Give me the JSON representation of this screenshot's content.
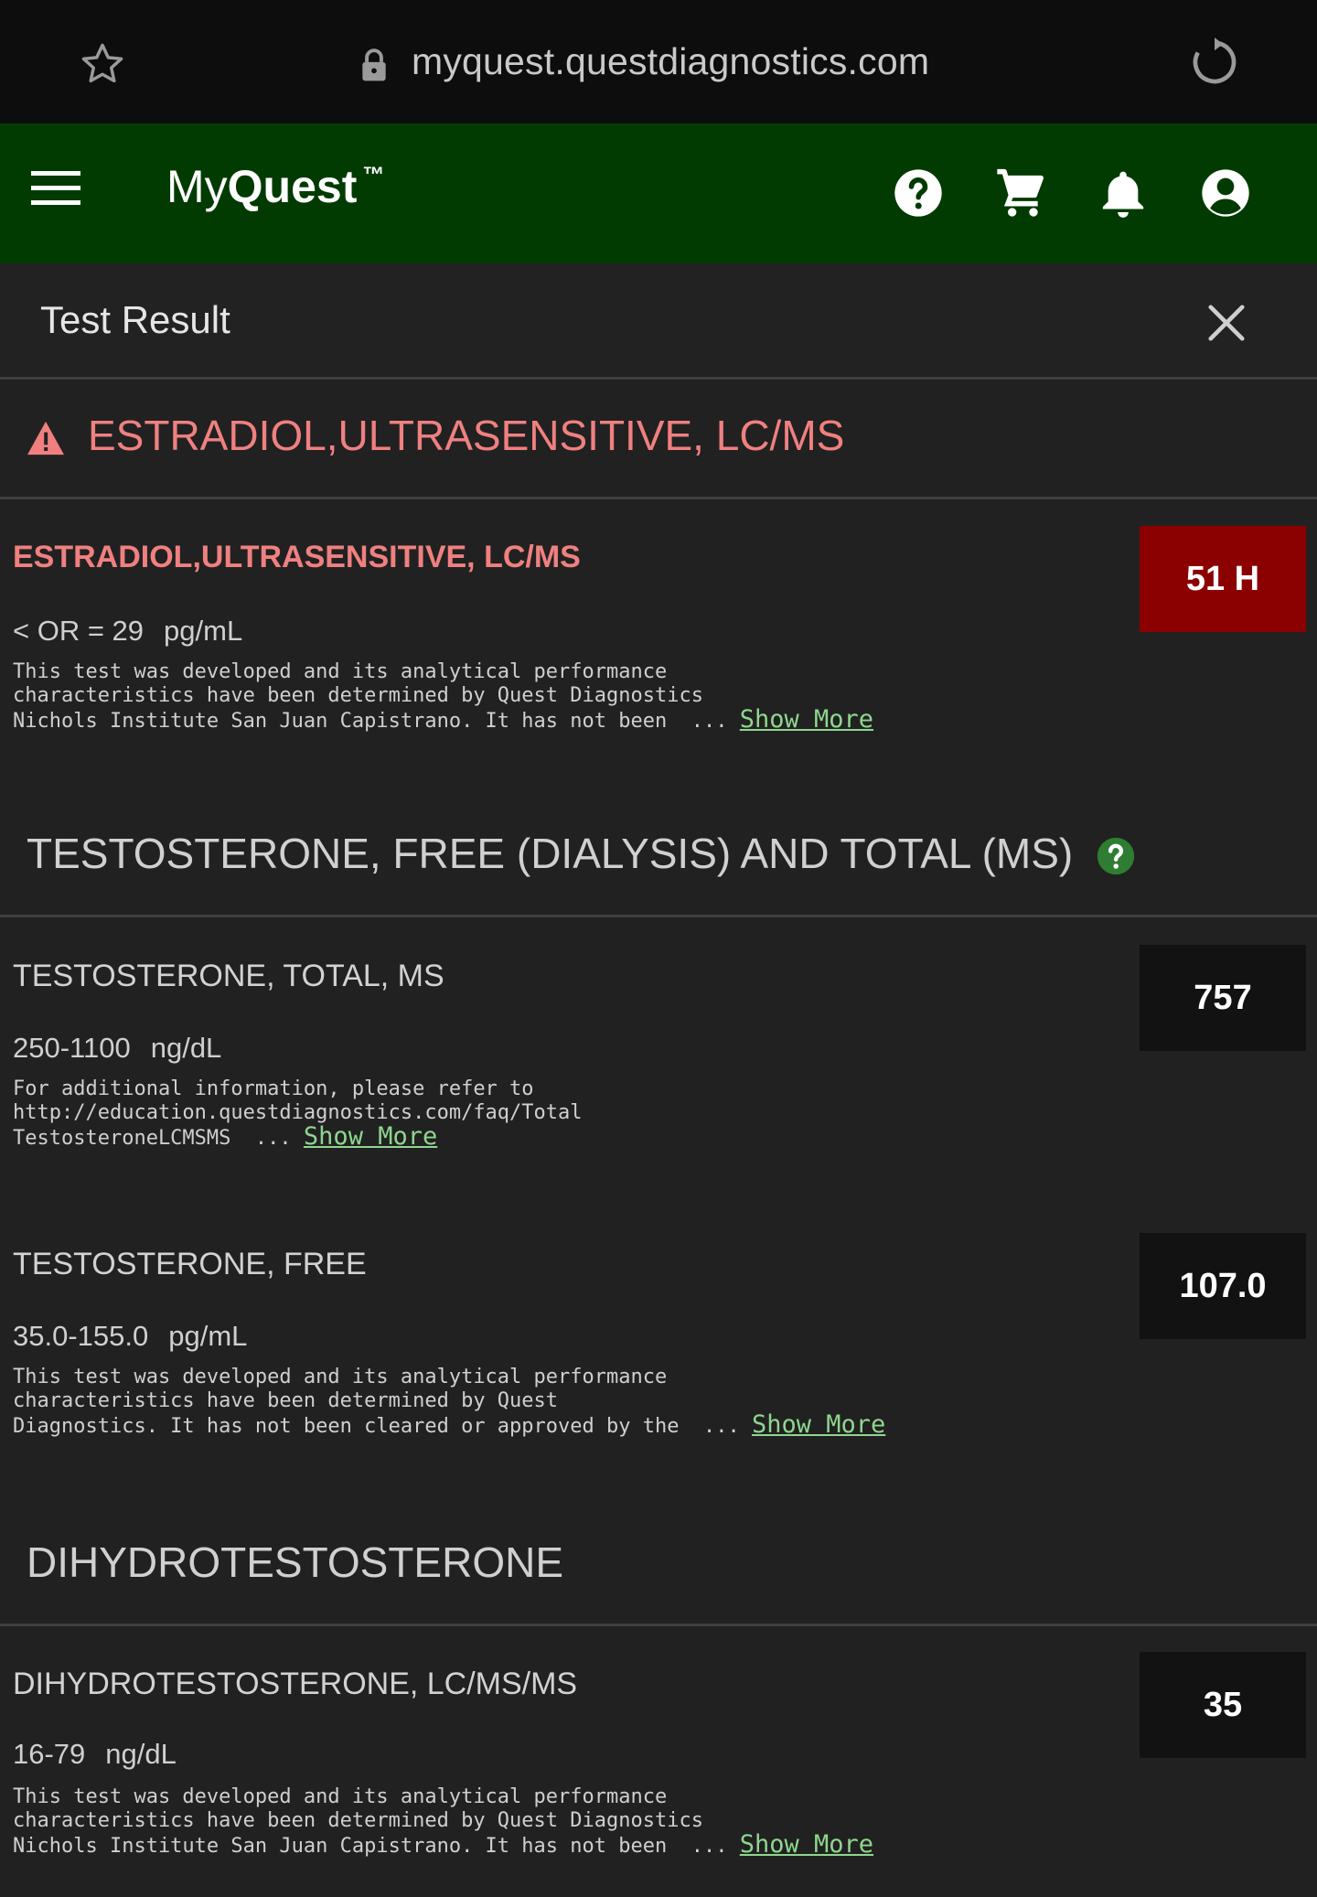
{
  "browser": {
    "url": "myquest.questdiagnostics.com",
    "icons": [
      "star-icon",
      "lock-icon",
      "reload-icon"
    ]
  },
  "appbar": {
    "brand_my": "My",
    "brand_quest": "Quest",
    "brand_tm": "™",
    "icons": [
      "menu-icon",
      "help-icon",
      "cart-icon",
      "bell-icon",
      "account-icon"
    ],
    "color": "#023b02"
  },
  "subheader": {
    "title": "Test Result",
    "close_icon": "close-icon"
  },
  "sections": [
    {
      "title": "ESTRADIOL,ULTRASENSITIVE, LC/MS",
      "alert": true,
      "results": [
        {
          "name": "ESTRADIOL,ULTRASENSITIVE, LC/MS",
          "range": "< OR = 29",
          "unit": "pg/mL",
          "value": "51 H",
          "flag": "high",
          "note_lines": [
            "This test was developed and its analytical performance",
            "characteristics have been determined by Quest Diagnostics",
            "Nichols Institute San Juan Capistrano. It has not been"
          ],
          "ellipsis": "...",
          "show_more": "Show More"
        }
      ]
    },
    {
      "title": "TESTOSTERONE, FREE (DIALYSIS) AND TOTAL (MS)",
      "help_icon": "help-icon",
      "results": [
        {
          "name": "TESTOSTERONE, TOTAL, MS",
          "range": "250-1100",
          "unit": "ng/dL",
          "value": "757",
          "note_lines": [
            "For additional information, please refer to",
            "http://education.questdiagnostics.com/faq/Total",
            "TestosteroneLCMSMS"
          ],
          "ellipsis": "...",
          "show_more": "Show More"
        },
        {
          "name": "TESTOSTERONE, FREE",
          "range": "35.0-155.0",
          "unit": "pg/mL",
          "value": "107.0",
          "note_lines": [
            "This test was developed and its analytical performance",
            "characteristics have been determined by Quest",
            "Diagnostics. It has not been cleared or approved by the"
          ],
          "ellipsis": "...",
          "show_more": "Show More"
        }
      ]
    },
    {
      "title": "DIHYDROTESTOSTERONE",
      "results": [
        {
          "name": "DIHYDROTESTOSTERONE, LC/MS/MS",
          "range": "16-79",
          "unit": "ng/dL",
          "value": "35",
          "note_lines": [
            "This test was developed and its analytical performance",
            "characteristics have been determined by Quest Diagnostics",
            "Nichols Institute San Juan Capistrano. It has not been"
          ],
          "ellipsis": "...",
          "show_more": "Show More"
        }
      ]
    }
  ],
  "colors": {
    "alert_text": "#f08080",
    "high_value_bg": "#8b0000",
    "link": "#8fd68f",
    "help_green": "#2e7d32"
  }
}
